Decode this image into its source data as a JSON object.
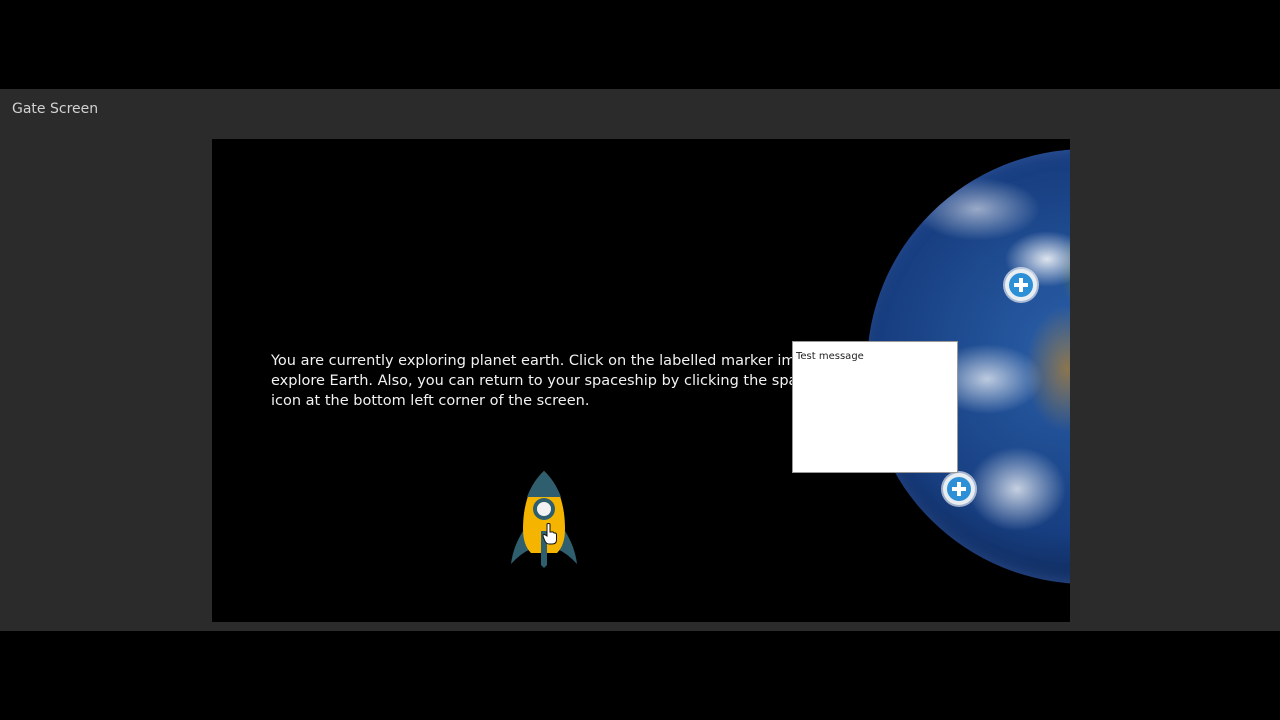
{
  "window": {
    "title": "Gate Screen"
  },
  "scene": {
    "instructions": "You are currently exploring planet earth. Click on the labelled marker images to explore Earth. Also, you can return to your spaceship by clicking the spaceship icon at the bottom left corner of the screen.",
    "message_box": {
      "text": "Test message"
    },
    "markers": [
      {
        "icon": "plus-marker-icon"
      },
      {
        "icon": "plus-marker-icon"
      }
    ],
    "spaceship": {
      "icon": "rocket-icon"
    }
  },
  "colors": {
    "frame_bg": "#2b2b2b",
    "stage_bg": "#000000",
    "marker_blue": "#2d8fd6",
    "rocket_yellow": "#f5b400",
    "rocket_teal": "#2f5f6e"
  }
}
